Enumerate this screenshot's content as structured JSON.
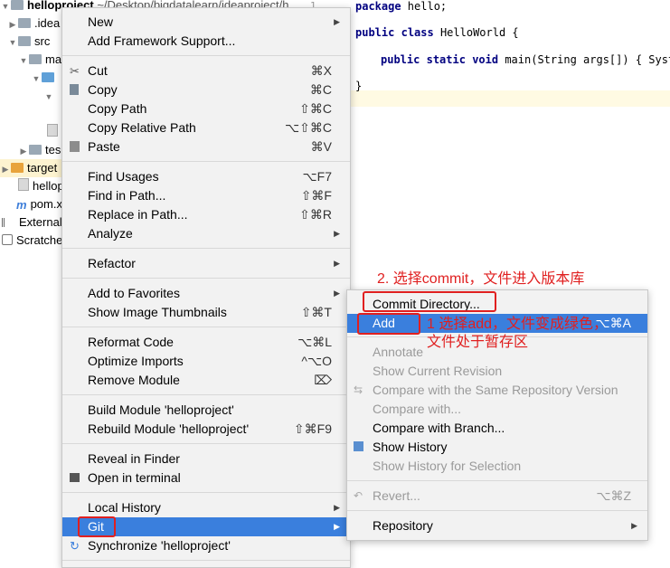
{
  "tree": {
    "root_label": "helloproject",
    "root_path": "~/Desktop/bigdatalearn/ideaproject/h",
    "idea": ".idea",
    "src": "src",
    "main_partial": "ma",
    "test_partial": "tes",
    "target_partial": "target",
    "hello_file_partial": "hellop",
    "pom_partial": "pom.x",
    "external": "External",
    "scratches": "Scratche"
  },
  "editor": {
    "line_number": "1",
    "line1": "package hello;",
    "line2_kw1": "public",
    "line2_kw2": "class",
    "line2_rest": "HelloWorld {",
    "line3_kw1": "public",
    "line3_kw2": "static",
    "line3_kw3": "void",
    "line3_rest": "main(String args[]) { Syste",
    "line4": "}"
  },
  "menu": {
    "new": "New",
    "add_framework": "Add Framework Support...",
    "cut": "Cut",
    "cut_sc": "⌘X",
    "copy": "Copy",
    "copy_sc": "⌘C",
    "copy_path": "Copy Path",
    "copy_path_sc": "⇧⌘C",
    "copy_rel": "Copy Relative Path",
    "copy_rel_sc": "⌥⇧⌘C",
    "paste": "Paste",
    "paste_sc": "⌘V",
    "find_usages": "Find Usages",
    "find_usages_sc": "⌥F7",
    "find_in_path": "Find in Path...",
    "find_in_path_sc": "⇧⌘F",
    "replace_in_path": "Replace in Path...",
    "replace_in_path_sc": "⇧⌘R",
    "analyze": "Analyze",
    "refactor": "Refactor",
    "add_favorites": "Add to Favorites",
    "show_thumbs": "Show Image Thumbnails",
    "show_thumbs_sc": "⇧⌘T",
    "reformat": "Reformat Code",
    "reformat_sc": "⌥⌘L",
    "optimize": "Optimize Imports",
    "optimize_sc": "^⌥O",
    "remove_module": "Remove Module",
    "remove_module_sc": "⌦",
    "build_module": "Build Module 'helloproject'",
    "rebuild_module": "Rebuild Module 'helloproject'",
    "rebuild_module_sc": "⇧⌘F9",
    "reveal": "Reveal in Finder",
    "open_terminal": "Open in terminal",
    "local_history": "Local History",
    "git": "Git",
    "synchronize": "Synchronize 'helloproject'"
  },
  "git_menu": {
    "commit_dir": "Commit Directory...",
    "add": "Add",
    "add_sc": "⌥⌘A",
    "annotate": "Annotate",
    "show_current": "Show Current Revision",
    "compare_same": "Compare with the Same Repository Version",
    "compare_with": "Compare with...",
    "compare_branch": "Compare with Branch...",
    "show_history": "Show History",
    "show_history_sel": "Show History for Selection",
    "revert": "Revert...",
    "revert_sc": "⌥⌘Z",
    "repository": "Repository"
  },
  "annotations": {
    "step2": "2. 选择commit，文件进入版本库",
    "step1_line1": "1 选择add，文件变成绿色，",
    "step1_line2": "文件处于暂存区"
  },
  "colors": {
    "highlight": "#3a7fdd",
    "annotation_red": "#e02020"
  }
}
